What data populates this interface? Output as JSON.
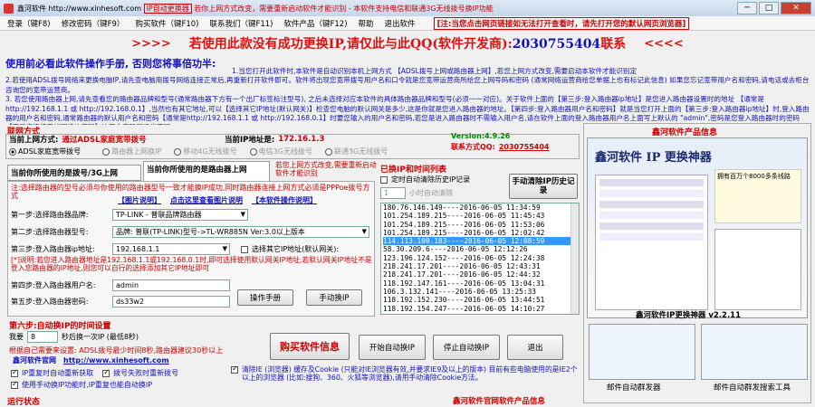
{
  "window": {
    "title_prefix": "鑫河软件 http://www.xinhesoft.com",
    "title_tag": "IP自动更换器",
    "title_suffix": "若你上网方式改变，需要重新启动软件才能识别 - 本软件支持电信和联通3G无线拨号换IP功能",
    "minimize": "─",
    "maximize": "□",
    "close": "✕"
  },
  "menu": {
    "items": [
      "登录（键F8)",
      "修改密码（键F9）",
      "购买软件（键F10)",
      "联系我们（键F11)",
      "软件产品（键F12)",
      "帮助",
      "退出软件"
    ],
    "notice": "[注:当您点击网页链接如无法打开查看时，请先打开您的默认网页浏览器]"
  },
  "banner": {
    "left_arrows": ">>>>",
    "text": "若使用此款没有成功更换IP,请仅此与此QQ(软件开发商):",
    "qq": "2030755404",
    "text_end": "联系",
    "right_arrows": "<<<<"
  },
  "manual_line": "使用前必看此软件操作手册, 否则您将事倍功半:",
  "notice_lines": [
    "1.当您打开此软件时,本软件是自动识别本机上网方式 【ADSL拨号上网或路由器上网】,若您上网方式改变,需要启动本软件才能识别定",
    "2.若使用ADSL拨号网络来更换电脑IP,请先查电脑用拨号网络连接正常后,再重新打开软件即可。软件将出现您宽带拨号用户名和口令就是您宽带运营商所给您上网号码和密码 (通常网络运营商给您单据上也有标记此信息) 如果您忘记宽带用户名和密码,请电话或去柜台咨询您的宽带运营商。",
    "3. 若您使用路由器上网,请先查看您的路由器品牌和型号(通常路由器下方有一个出厂标签标注型号), 之后未选择对应本软件的具体路由器品牌和型号(必须一一对应)。关于软件上面的【第三步:登入路由器ip地址】是您进入路由器设置时的地址 【通常是http://192.168.1.1 或 http://192.168.0.1】,当然也有其它地址,可以【选择其它IP地址(默认网关)】检查您电脑的默认网关是多少,这是你就是您进入路由器的地址。【第四步:登入路由器用户名和密码】就是当您打开上面的【第三步:登入路由器ip地址】时,登入路由器的用户名和密码,通常路由器的默认用户名和密码【通常是http://192.168.1.1 或 http://192.168.0.1】时要您输入的用户名和密码,若您是进入路由器时不需输入用户名,请在软件上面的登入路由器用户名上面写上默认的 \"admin\",密码是您登入路由器时的密码 【不是您连接无线网络的密码】这两个密码是通常不同。"
  ],
  "network": {
    "section_label": "联网方式",
    "current_mode_label": "当前上网方式:",
    "current_mode_value": "通过ADSL家庭宽带拨号",
    "current_ip_label": "当前IP地址是:",
    "current_ip_value": "172.16.1.3",
    "version": "Version:4.9.26",
    "contact_label": "联系方式QQ:",
    "contact_qq": "2030755404",
    "radios": [
      "ADSL家庭宽带拨号",
      "路由器上网换IP",
      "移动4G无线拨号",
      "电信3G无线拨号",
      "联通3G无线拨号"
    ]
  },
  "tabs": {
    "tab1": "当前你所使用的是拨号/3G上网",
    "tab2": "当前你所使用的是路由器上网",
    "side_note": "若您上网方式改变,需要重新启动软件才能识别"
  },
  "router": {
    "warning": "注:选择路由器的型号必须与你使用的路由器型号一致才能换IP成功,同时路由器连接上网方式必须是PPPoe拨号方式",
    "link_photo": "【图片说明】",
    "link_view_photo": "点击这里查看图片说明",
    "link_text": "【本软件操作说明】",
    "step1_label": "第一步:选择路由器品牌:",
    "step1_value": "TP-LINK - 普联品牌路由器",
    "step2_label": "第二步:选择路由器型号:",
    "step2_value": "品牌: 普联(TP-LINK)型号->TL-WR885N Ver:3.0以上版本",
    "step3_label": "第三步:登入路由器ip地址:",
    "step3_value": "192.168.1.1",
    "other_ip_label": "选择其它IP地址(默认网关):",
    "note": "[*]说明:若您进入路由器地址是192.168.1.1或192.168.0.1时,即可选择使用默认网关IP地址,若默认网关IP地址不是登入您路由器的IP地址,则您可以自行的选择添加其它IP地址即可",
    "step4_label": "第四步:登入路由器用户名:",
    "step4_value": "admin",
    "step5_label": "第五步:登入路由器密码:",
    "step5_value": "ds33w2",
    "manual_button": "操作手册",
    "manual_change_button": "手动换IP"
  },
  "schedule": {
    "label": "第六步:自动换IP的时间设置",
    "every_label": "我要",
    "every_value": "8",
    "every_suffix": "秒后换一次IP (最低8秒)",
    "hint": "根据自己需要来设置: ADSL拨号最少时间8秒,路由器建议30秒以上",
    "site_label": "鑫河软件官网",
    "site_url": "http://www.xinhesoft.com",
    "chk1": "IP重复时自动重新获取",
    "chk2": "拨号失败时重新拨号",
    "chk3": "使用手动换IP功能时,IP重复也能自动换IP",
    "clear_cookies": "清除IE (浏览器) 缓存及Cookie (只能对IE浏览器有效,并要求IE9及以上的版本) 目前有些电脑使用的是IE2个以上的浏览器 (比如:搜狗、360、火狐等浏览器),请用手动清除Cookie方法。",
    "status_label": "运行状态"
  },
  "history": {
    "label": "已换IP和时间列表",
    "clear_chk": "定时自动清除历史IP记录",
    "hours_value": "1",
    "hours_suffix": "小时自动清除",
    "clear_button": "手动清除IP历史记录",
    "entries": [
      "180.76.146.149----2016-06-05 11:34:59",
      "101.254.189.215----2016-06-05 11:45:43",
      "101.254.189.215----2016-06-05 11:53:06",
      "101.254.189.215----2016-06-05 12:02:42",
      "114.113.100.183----2016-06-05 12:08:59",
      "58.30.209.6----2016-06-05 12:12:26",
      "123.196.124.152----2016-06-05 12:24:38",
      "218.241.17.201----2016-06-05 12:43:31",
      "218.241.17.201----2016-06-05 12:44:32",
      "118.192.147.161----2016-06-05 13:04:31",
      "106.3.132.141----2016-06-05 13:25:33",
      "118.192.152.230----2016-06-05 13:44:51",
      "118.192.154.247----2016-06-05 14:10:27"
    ]
  },
  "actions": {
    "buy": "购买软件信息",
    "start": "开始自动换IP",
    "stop": "停止自动换IP",
    "exit": "退出"
  },
  "products": {
    "header": "鑫河软件产品信息",
    "product_title": "鑫河软件 IP 更换神器",
    "product_caption": "鑫河软件IP更换神器 v2.2.11",
    "slogan": "拥有百万个8000多条线路",
    "small1": "邮件自动群发器",
    "small2": "邮件自动群发搜索工具",
    "footer_header": "鑫河软件官网软件产品信息"
  }
}
